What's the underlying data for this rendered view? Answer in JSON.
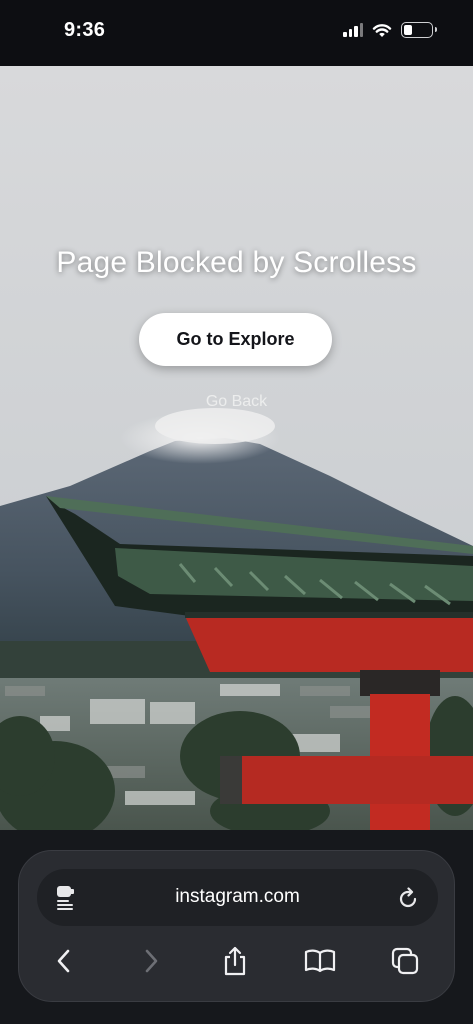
{
  "status_bar": {
    "time": "9:36",
    "icons": [
      "signal-icon",
      "wifi-icon",
      "battery-icon"
    ]
  },
  "page": {
    "title": "Page Blocked by Scrolless",
    "primary_button": "Go to Explore",
    "secondary_link": "Go Back",
    "background_image": "torii gate and Mount Fuji photo"
  },
  "browser": {
    "url": "instagram.com",
    "left_icon": "reader-mode-icon",
    "right_icon": "reload-icon",
    "nav": [
      {
        "name": "back-icon",
        "enabled": true
      },
      {
        "name": "forward-icon",
        "enabled": false
      },
      {
        "name": "share-icon",
        "enabled": true
      },
      {
        "name": "bookmarks-icon",
        "enabled": true
      },
      {
        "name": "tabs-icon",
        "enabled": true
      }
    ]
  },
  "colors": {
    "chrome_bg": "#16181c",
    "toolbar_bg": "#2a2c31",
    "button_bg": "#ffffff",
    "torii_red": "#b82a22"
  }
}
